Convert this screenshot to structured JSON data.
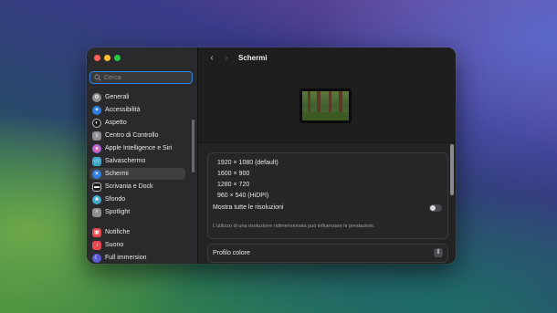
{
  "window": {
    "title": "Schermi"
  },
  "search": {
    "placeholder": "Cerca"
  },
  "sidebar": {
    "items": [
      {
        "label": "Generali",
        "icon": "gear-icon",
        "color": "#8e8e93"
      },
      {
        "label": "Accessibilità",
        "icon": "accessibility-icon",
        "color": "#2f7fe0"
      },
      {
        "label": "Aspetto",
        "icon": "appearance-icon",
        "color": "#1c1c1e"
      },
      {
        "label": "Centro di Controllo",
        "icon": "control-center-icon",
        "color": "#8e8e93"
      },
      {
        "label": "Apple Intelligence e Siri",
        "icon": "siri-icon",
        "color": "#c25bd9"
      },
      {
        "label": "Salvaschermo",
        "icon": "screensaver-icon",
        "color": "#3fa7c9"
      },
      {
        "label": "Schermi",
        "icon": "displays-icon",
        "color": "#2f7fe0",
        "selected": true
      },
      {
        "label": "Scrivania e Dock",
        "icon": "dock-icon",
        "color": "#1c1c1e"
      },
      {
        "label": "Sfondo",
        "icon": "wallpaper-icon",
        "color": "#3fa7c9"
      },
      {
        "label": "Spotlight",
        "icon": "spotlight-icon",
        "color": "#8e8e93"
      },
      {
        "label": "Notifiche",
        "icon": "notifications-icon",
        "color": "#e5484d"
      },
      {
        "label": "Suono",
        "icon": "sound-icon",
        "color": "#e5484d"
      },
      {
        "label": "Full immersion",
        "icon": "focus-icon",
        "color": "#5b5bd6"
      }
    ]
  },
  "display": {
    "resolutions": [
      "1920 × 1080 (default)",
      "1600 × 900",
      "1280 × 720",
      "960 × 540 (HiDPI)"
    ],
    "show_all_label": "Mostra tutte le risoluzioni",
    "show_all_enabled": false,
    "note": "L'utilizzo di una risoluzione ridimensionata può influenzare le prestazioni.",
    "color_profile_label": "Profilo colore"
  },
  "colors": {
    "accent": "#2f7fe0"
  }
}
